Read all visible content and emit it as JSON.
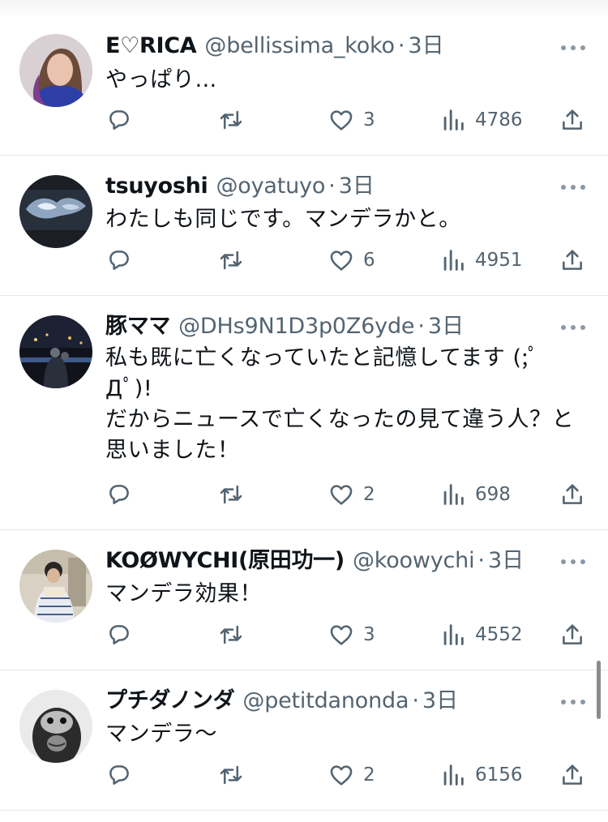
{
  "tweets": [
    {
      "name": "E♡RICA",
      "handle": "@bellissima_koko",
      "separator": "·",
      "time": "3日",
      "text_lines": [
        "やっぱり…"
      ],
      "replies": "",
      "retweets": "",
      "likes": "3",
      "views": "4786"
    },
    {
      "name": "tsuyoshi",
      "handle": "@oyatuyo",
      "separator": "·",
      "time": "3日",
      "text_lines": [
        "わたしも同じです。マンデラかと。"
      ],
      "replies": "",
      "retweets": "",
      "likes": "6",
      "views": "4951"
    },
    {
      "name": "豚ママ",
      "handle": "@DHs9N1D3p0Z6yde",
      "separator": "·",
      "time": "3日",
      "text_lines": [
        "私も既に亡くなっていたと記憶してます (;ﾟ",
        "Дﾟ)!",
        "だからニュースで亡くなったの見て違う人？と",
        "思いました！"
      ],
      "replies": "",
      "retweets": "",
      "likes": "2",
      "views": "698"
    },
    {
      "name": "KOØWYCHI(原田功一)",
      "handle": "@koowychi",
      "separator": "·",
      "time": "3日",
      "text_lines": [
        "マンデラ効果！"
      ],
      "replies": "",
      "retweets": "",
      "likes": "3",
      "views": "4552"
    },
    {
      "name": "プチダノンダ",
      "handle": "@petitdanonda",
      "separator": "·",
      "time": "3日",
      "text_lines": [
        "マンデラ〜"
      ],
      "replies": "",
      "retweets": "",
      "likes": "2",
      "views": "6156"
    }
  ],
  "icons": {
    "reply": "speech-bubble-icon",
    "retweet": "retweet-arrows-icon",
    "like": "heart-icon",
    "views": "bar-chart-icon",
    "share": "share-upload-icon",
    "more": "more-dots-icon"
  },
  "colors": {
    "text": "#0f1419",
    "secondary": "#536471",
    "divider": "#e3e6e8",
    "background": "#ffffff"
  }
}
